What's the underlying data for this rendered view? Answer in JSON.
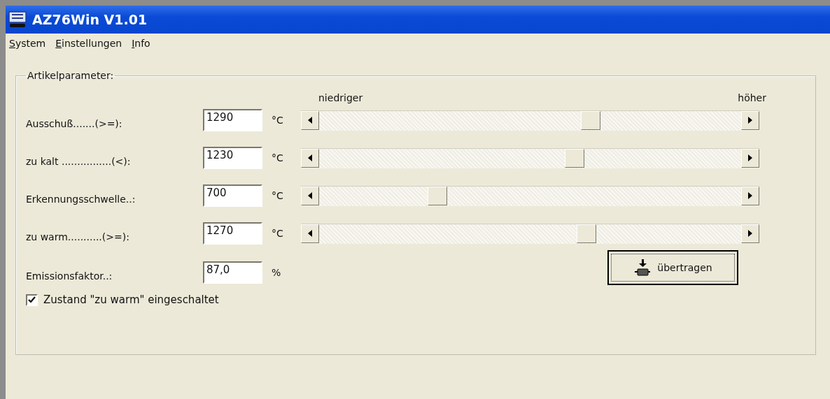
{
  "window": {
    "title": "AZ76Win V1.01"
  },
  "menu": [
    {
      "label": "System"
    },
    {
      "label": "Einstellungen"
    },
    {
      "label": "Info"
    }
  ],
  "group": {
    "title": "Artikelparameter:",
    "scale_low": "niedriger",
    "scale_high": "höher",
    "params": [
      {
        "kind": "slider",
        "label": "Ausschuß.......(>=):",
        "value": "1290",
        "unit": "°C",
        "level": 0.65
      },
      {
        "kind": "slider",
        "label": "zu kalt ................(<):",
        "value": "1230",
        "unit": "°C",
        "level": 0.61
      },
      {
        "kind": "slider",
        "label": "Erkennungsschwelle..:",
        "value": "700",
        "unit": "°C",
        "level": 0.27
      },
      {
        "kind": "slider",
        "label": "zu warm...........(>=):",
        "value": "1270",
        "unit": "°C",
        "level": 0.64
      },
      {
        "kind": "plain",
        "label": "Emissionsfaktor..:",
        "value": "87,0",
        "unit": "%"
      }
    ],
    "checkbox": {
      "label": "Zustand \"zu warm\" eingeschaltet",
      "checked": true
    },
    "button": {
      "label": "übertragen"
    }
  }
}
